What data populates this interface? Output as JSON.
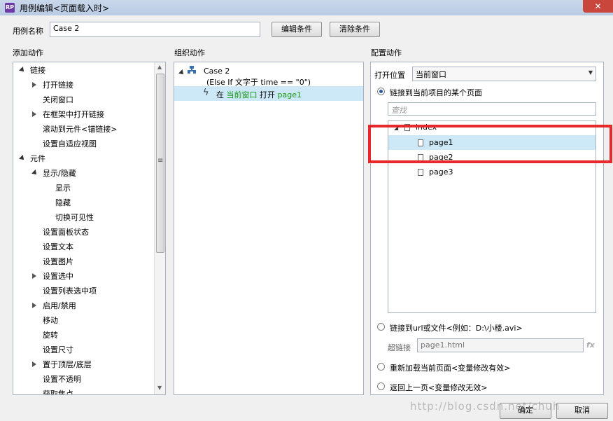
{
  "window": {
    "title": "用例编辑<页面载入时>",
    "app_badge": "RP",
    "close_glyph": "✕"
  },
  "case_name": {
    "label": "用例名称",
    "value": "Case 2"
  },
  "buttons": {
    "edit_condition": "编辑条件",
    "clear_condition": "清除条件",
    "ok": "确定",
    "cancel": "取消"
  },
  "add_actions": {
    "header": "添加动作",
    "items": [
      {
        "label": "链接",
        "level": 0,
        "arrow": "open"
      },
      {
        "label": "打开链接",
        "level": 1,
        "arrow": "closed"
      },
      {
        "label": "关闭窗口",
        "level": 1,
        "arrow": ""
      },
      {
        "label": "在框架中打开链接",
        "level": 1,
        "arrow": "closed"
      },
      {
        "label": "滚动到元件<锚链接>",
        "level": 1,
        "arrow": ""
      },
      {
        "label": "设置自适应视图",
        "level": 1,
        "arrow": ""
      },
      {
        "label": "元件",
        "level": 0,
        "arrow": "open"
      },
      {
        "label": "显示/隐藏",
        "level": 1,
        "arrow": "open"
      },
      {
        "label": "显示",
        "level": 2,
        "arrow": ""
      },
      {
        "label": "隐藏",
        "level": 2,
        "arrow": ""
      },
      {
        "label": "切换可见性",
        "level": 2,
        "arrow": ""
      },
      {
        "label": "设置面板状态",
        "level": 1,
        "arrow": ""
      },
      {
        "label": "设置文本",
        "level": 1,
        "arrow": ""
      },
      {
        "label": "设置图片",
        "level": 1,
        "arrow": ""
      },
      {
        "label": "设置选中",
        "level": 1,
        "arrow": "closed"
      },
      {
        "label": "设置列表选中项",
        "level": 1,
        "arrow": ""
      },
      {
        "label": "启用/禁用",
        "level": 1,
        "arrow": "closed"
      },
      {
        "label": "移动",
        "level": 1,
        "arrow": ""
      },
      {
        "label": "旋转",
        "level": 1,
        "arrow": ""
      },
      {
        "label": "设置尺寸",
        "level": 1,
        "arrow": ""
      },
      {
        "label": "置于顶层/底层",
        "level": 1,
        "arrow": "closed"
      },
      {
        "label": "设置不透明",
        "level": 1,
        "arrow": ""
      },
      {
        "label": "获取焦点",
        "level": 1,
        "arrow": ""
      }
    ],
    "scroll_grip": "≡"
  },
  "organize": {
    "header": "组织动作",
    "case_label": "Case 2",
    "condition": "(Else If 文字于 time == \"0\")",
    "action_prefix": "在",
    "action_target": "当前窗口",
    "action_verb": "打开",
    "action_page": "page1"
  },
  "configure": {
    "header": "配置动作",
    "open_in_label": "打开位置",
    "open_in_value": "当前窗口",
    "radio_link_page": "链接到当前项目的某个页面",
    "search_placeholder": "查找",
    "pages": {
      "root": "index",
      "children": [
        "page1",
        "page2",
        "page3"
      ],
      "selected": "page1"
    },
    "radio_link_url": "链接到url或文件<例如：D:\\小楼.avi>",
    "hyperlink_label": "超链接",
    "hyperlink_value": "page1.html",
    "fx": "fx",
    "radio_reload": "重新加载当前页面<变量修改有效>",
    "radio_back": "返回上一页<变量修改无效>"
  },
  "watermark": "http://blog.csdn.net/chuh"
}
